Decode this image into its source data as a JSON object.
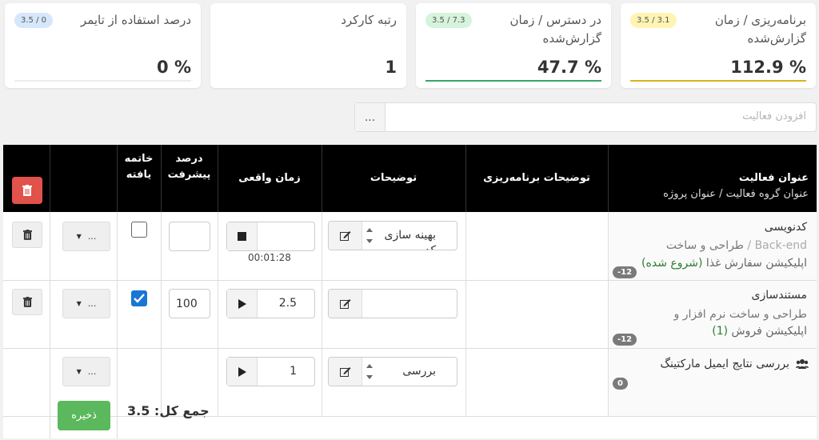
{
  "cards": [
    {
      "title": "برنامه‌ریزی / زمان\nگزارش‌شده",
      "value": "% 112.9",
      "badge": "3.5 / 3.1",
      "badge_color": "#fff4b3",
      "bar_color": "#d9b51c",
      "fill_percent": 100
    },
    {
      "title": "در دسترس / زمان\nگزارش‌شده",
      "value": "% 47.7",
      "badge": "3.5 / 7.3",
      "badge_color": "#d6f3dc",
      "bar_color": "#3aa36a",
      "fill_percent": 47.7
    },
    {
      "title": "رتبه کارکرد",
      "value": "1",
      "badge": "",
      "badge_color": "",
      "bar_color": "",
      "fill_percent": 0
    },
    {
      "title": "درصد استفاده از تایمر",
      "value": "% 0",
      "badge": "3.5 / 0",
      "badge_color": "#d6e7fb",
      "bar_color": "#1976d2",
      "fill_percent": 0
    }
  ],
  "add_activity": {
    "placeholder": "افزودن فعالیت",
    "more_label": "..."
  },
  "table": {
    "headers": {
      "activity_title": "عنوان فعالیت",
      "activity_sub": "عنوان گروه فعالیت  / عنوان پروژه",
      "planning_desc": "توضیحات برنامه‌ریزی",
      "desc": "توضیحات",
      "actual_time": "زمان واقعی",
      "progress": "درصد\nپیشرفت",
      "finished": "خاتمه\nیافته"
    },
    "rows": [
      {
        "title": "کدنویسی",
        "group_muted": "Back-end",
        "group": "طراحی و ساخت",
        "project": "اپلیکیشن سفارش غذا",
        "status": "(شروع شده)",
        "pill": "-12",
        "desc": "بهینه سازی",
        "desc_line2": "کد",
        "time_value": "",
        "timer_text": "00:01:28",
        "timer_state": "stop",
        "progress": "",
        "finished": false,
        "dropdown": "..."
      },
      {
        "title": "مستندسازی",
        "group": "طراحی و ساخت نرم افزار و",
        "project": "اپلیکیشن فروش",
        "status": "(1)",
        "pill": "-12",
        "desc": "",
        "time_value": "2.5",
        "timer_state": "play",
        "progress": "100",
        "finished": true,
        "dropdown": "..."
      },
      {
        "title": "بررسی نتایج ایمیل مارکتینگ",
        "pill": "0",
        "desc": "بررسی",
        "time_value": "1",
        "timer_state": "play",
        "dropdown": "..."
      }
    ],
    "total": "جمع کل: 3.5",
    "save_label": "ذخیره"
  }
}
